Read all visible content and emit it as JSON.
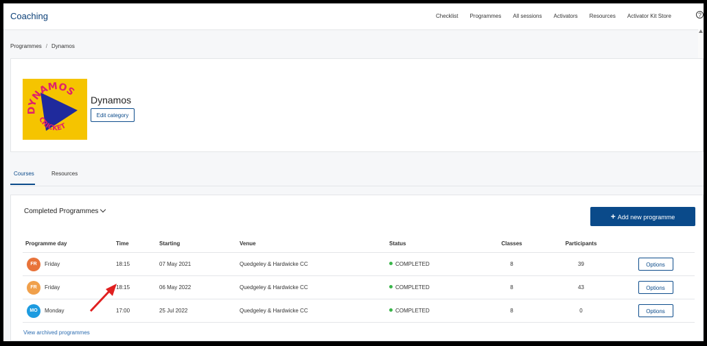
{
  "app": {
    "brand": "Coaching",
    "accent_color": "#0a4a8a"
  },
  "nav": {
    "links": [
      "Checklist",
      "Programmes",
      "All sessions",
      "Activators",
      "Resources",
      "Activator Kit Store"
    ],
    "help_icon": "question-circle-icon",
    "help_glyph": "?"
  },
  "breadcrumb": {
    "items": [
      "Programmes",
      "Dynamos"
    ],
    "separator": "/"
  },
  "category": {
    "title": "Dynamos",
    "edit_label": "Edit category",
    "logo_text_top": "DYNAMOS",
    "logo_text_bottom": "CRICKET",
    "logo_bg": "#f5c400"
  },
  "tabs": [
    {
      "label": "Courses",
      "active": true
    },
    {
      "label": "Resources",
      "active": false
    }
  ],
  "programmes": {
    "filter_label": "Completed Programmes",
    "add_label": "Add new programme",
    "columns": [
      "Programme day",
      "Time",
      "Starting",
      "Venue",
      "Status",
      "Classes",
      "Participants",
      ""
    ],
    "rows": [
      {
        "badge": "FR",
        "badge_color": "#e8733a",
        "day": "Friday",
        "time": "18:15",
        "starting": "07 May 2021",
        "venue": "Quedgeley & Hardwicke CC",
        "status": "COMPLETED",
        "classes": "8",
        "participants": "39",
        "action": "Options"
      },
      {
        "badge": "FR",
        "badge_color": "#f0a04b",
        "day": "Friday",
        "time": "18:15",
        "starting": "06 May 2022",
        "venue": "Quedgeley & Hardwicke CC",
        "status": "COMPLETED",
        "classes": "8",
        "participants": "43",
        "action": "Options"
      },
      {
        "badge": "MO",
        "badge_color": "#1d9be0",
        "day": "Monday",
        "time": "17:00",
        "starting": "25 Jul 2022",
        "venue": "Quedgeley & Hardwicke CC",
        "status": "COMPLETED",
        "classes": "8",
        "participants": "0",
        "action": "Options"
      }
    ],
    "archived_link": "View archived programmes"
  }
}
